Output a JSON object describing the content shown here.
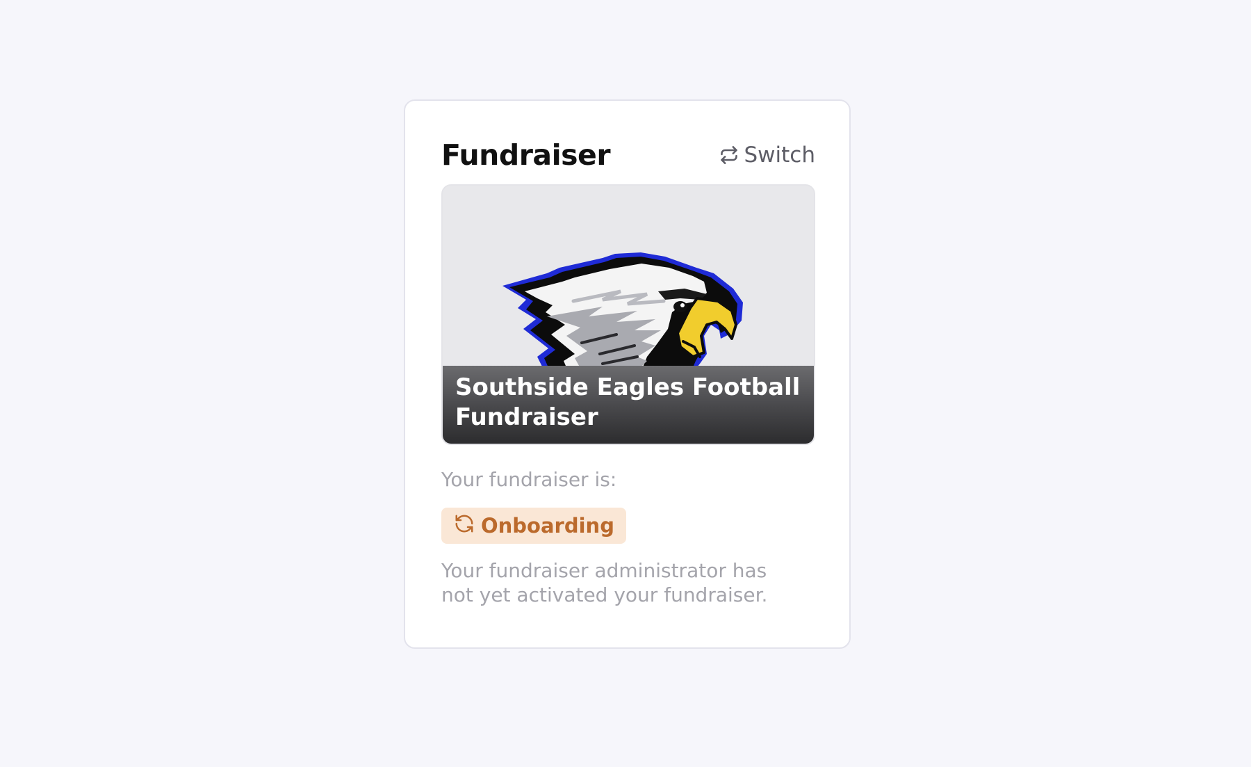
{
  "card": {
    "title": "Fundraiser",
    "switch_label": "Switch",
    "switch_icon": "repeat-icon"
  },
  "banner": {
    "logo": "eagle-mascot-logo",
    "caption": "Southside Eagles Football Fundraiser"
  },
  "status": {
    "label": "Your fundraiser is:",
    "badge_label": "Onboarding",
    "badge_icon": "refresh-icon",
    "description": "Your fundraiser administrator has not yet activated your fundraiser."
  },
  "colors": {
    "page_background": "#f6f6fb",
    "card_background": "#ffffff",
    "badge_background": "#fae7d6",
    "badge_text": "#bb6a2c",
    "muted_text": "#a4a4ab"
  }
}
